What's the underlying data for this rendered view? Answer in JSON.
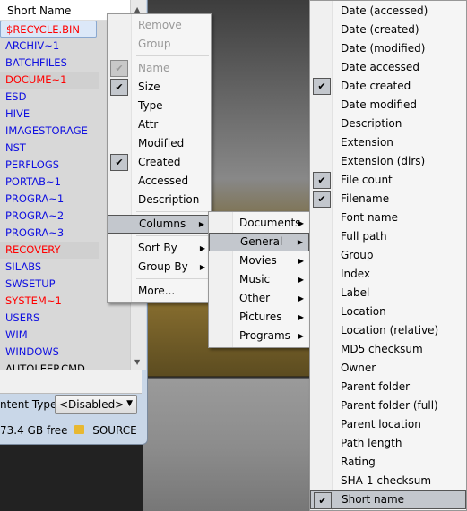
{
  "list": {
    "header": "Short Name",
    "rows": [
      {
        "name": "$RECYCLE.BIN",
        "color": "red"
      },
      {
        "name": "ARCHIV~1",
        "color": "blue"
      },
      {
        "name": "BATCHFILES",
        "color": "blue"
      },
      {
        "name": "DOCUME~1",
        "color": "red"
      },
      {
        "name": "ESD",
        "color": "blue"
      },
      {
        "name": "HIVE",
        "color": "blue"
      },
      {
        "name": "IMAGESTORAGE",
        "color": "blue"
      },
      {
        "name": "NST",
        "color": "blue"
      },
      {
        "name": "PERFLOGS",
        "color": "blue"
      },
      {
        "name": "PORTAB~1",
        "color": "blue"
      },
      {
        "name": "PROGRA~1",
        "color": "blue"
      },
      {
        "name": "PROGRA~2",
        "color": "blue"
      },
      {
        "name": "PROGRA~3",
        "color": "blue"
      },
      {
        "name": "RECOVERY",
        "color": "red"
      },
      {
        "name": "SILABS",
        "color": "blue"
      },
      {
        "name": "SWSETUP",
        "color": "blue"
      },
      {
        "name": "SYSTEM~1",
        "color": "red"
      },
      {
        "name": "USERS",
        "color": "blue"
      },
      {
        "name": "WIM",
        "color": "blue"
      },
      {
        "name": "WINDOWS",
        "color": "blue"
      },
      {
        "name": "AUTOLEEP.CMD",
        "color": "black"
      }
    ]
  },
  "content_type": {
    "label": "ntent Type",
    "value": "<Disabled>"
  },
  "status": {
    "free": "73.4 GB free",
    "label": "SOURCE"
  },
  "context_menu": {
    "items": [
      {
        "label": "Remove",
        "disabled": true
      },
      {
        "label": "Group",
        "disabled": true
      },
      {
        "sep": true
      },
      {
        "label": "Name",
        "checked": true,
        "disabled": true
      },
      {
        "label": "Size",
        "checked": true
      },
      {
        "label": "Type"
      },
      {
        "label": "Attr"
      },
      {
        "label": "Modified"
      },
      {
        "label": "Created",
        "checked": true
      },
      {
        "label": "Accessed"
      },
      {
        "label": "Description"
      },
      {
        "sep": true
      },
      {
        "label": "Columns",
        "submenu": true,
        "highlighted": true
      },
      {
        "sep": true
      },
      {
        "label": "Sort By",
        "submenu": true
      },
      {
        "label": "Group By",
        "submenu": true
      },
      {
        "sep": true
      },
      {
        "label": "More..."
      }
    ]
  },
  "columns_menu": {
    "items": [
      {
        "label": "Documents",
        "submenu": true
      },
      {
        "label": "General",
        "submenu": true,
        "highlighted": true
      },
      {
        "label": "Movies",
        "submenu": true
      },
      {
        "label": "Music",
        "submenu": true
      },
      {
        "label": "Other",
        "submenu": true
      },
      {
        "label": "Pictures",
        "submenu": true
      },
      {
        "label": "Programs",
        "submenu": true
      }
    ]
  },
  "general_menu": {
    "items": [
      {
        "label": "Date (accessed)"
      },
      {
        "label": "Date (created)"
      },
      {
        "label": "Date (modified)"
      },
      {
        "label": "Date accessed"
      },
      {
        "label": "Date created",
        "checked": true
      },
      {
        "label": "Date modified"
      },
      {
        "label": "Description"
      },
      {
        "label": "Extension"
      },
      {
        "label": "Extension (dirs)"
      },
      {
        "label": "File count",
        "checked": true
      },
      {
        "label": "Filename",
        "checked": true
      },
      {
        "label": "Font name"
      },
      {
        "label": "Full path"
      },
      {
        "label": "Group"
      },
      {
        "label": "Index"
      },
      {
        "label": "Label"
      },
      {
        "label": "Location"
      },
      {
        "label": "Location (relative)"
      },
      {
        "label": "MD5 checksum"
      },
      {
        "label": "Owner"
      },
      {
        "label": "Parent folder"
      },
      {
        "label": "Parent folder (full)"
      },
      {
        "label": "Parent location"
      },
      {
        "label": "Path length"
      },
      {
        "label": "Rating"
      },
      {
        "label": "SHA-1 checksum"
      },
      {
        "label": "Short name",
        "checked": true,
        "highlighted": true
      }
    ]
  }
}
